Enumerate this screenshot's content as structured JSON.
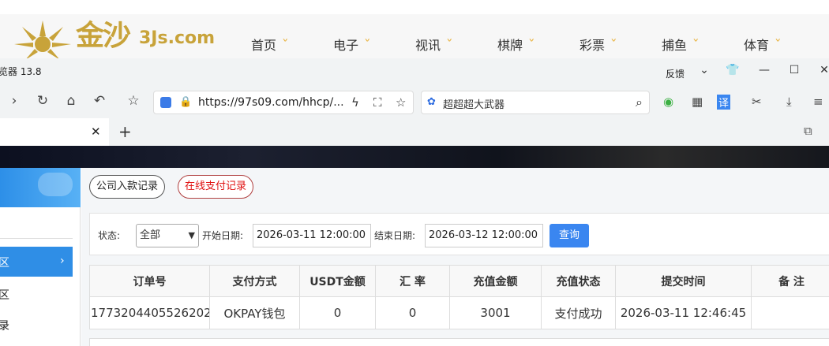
{
  "site": {
    "logo_cn": "金沙",
    "logo_en": "3Js.com",
    "nav": [
      "首页",
      "电子",
      "视讯",
      "棋牌",
      "彩票",
      "捕鱼",
      "体育"
    ]
  },
  "browser": {
    "app_title": "览器 13.8",
    "feedback": "反馈",
    "url": "https://97s09.com/hhcp/...",
    "search_placeholder": "超超超大武器"
  },
  "sidebar": {
    "active_item": "区",
    "items": [
      "区",
      "录"
    ]
  },
  "main": {
    "tabs": [
      "公司入款记录",
      "在线支付记录"
    ],
    "filter": {
      "status_label": "状态:",
      "status_value": "全部",
      "start_label": "开始日期:",
      "start_value": "2026-03-11 12:00:00",
      "end_label": "结束日期:",
      "end_value": "2026-03-12 12:00:00",
      "query": "查询"
    },
    "table": {
      "headers": [
        "订单号",
        "支付方式",
        "USDT金额",
        "汇 率",
        "充值金额",
        "充值状态",
        "提交时间",
        "备 注"
      ],
      "rows": [
        [
          "1773204405526202",
          "OKPAY钱包",
          "0",
          "0",
          "3001",
          "支付成功",
          "2026-03-11 12:46:45",
          ""
        ]
      ]
    }
  },
  "colors": {
    "accent": "#3a86f0",
    "brand_gold": "#c8a33a",
    "danger": "#e01010"
  }
}
